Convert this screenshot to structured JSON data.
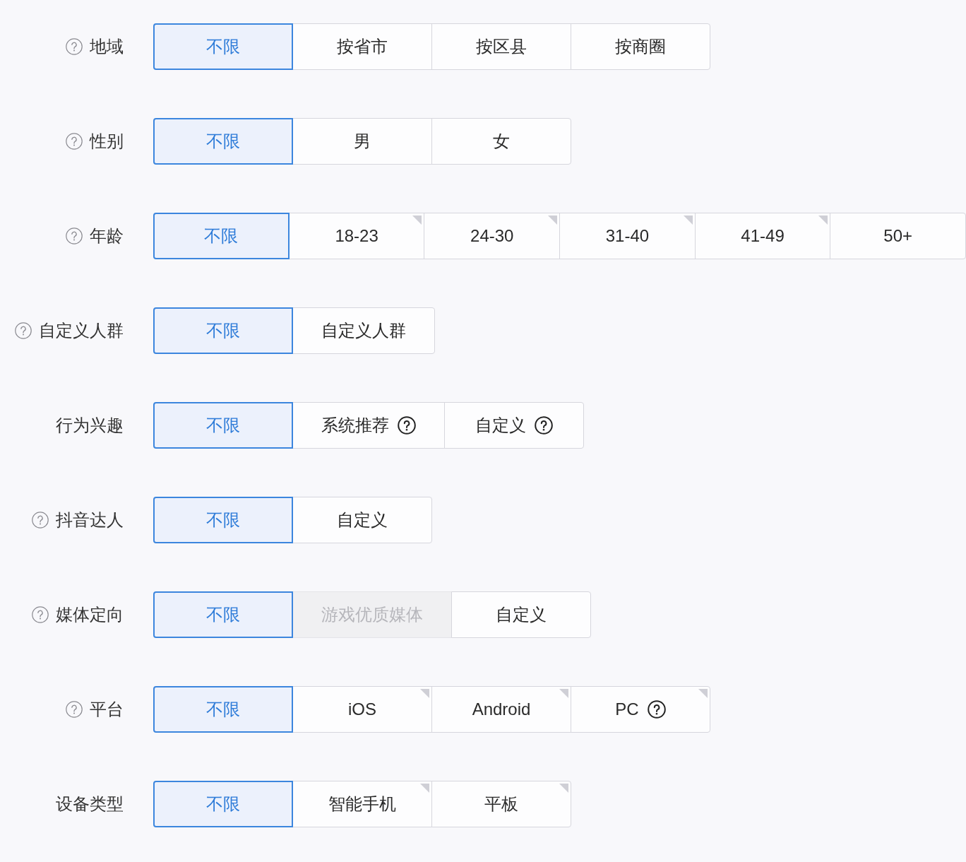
{
  "rows": [
    {
      "label": "地域",
      "help": true,
      "options": [
        {
          "label": "不限",
          "selected": true,
          "disabled": false,
          "corner_mark": false,
          "help": false
        },
        {
          "label": "按省市",
          "selected": false,
          "disabled": false,
          "corner_mark": false,
          "help": false
        },
        {
          "label": "按区县",
          "selected": false,
          "disabled": false,
          "corner_mark": false,
          "help": false
        },
        {
          "label": "按商圈",
          "selected": false,
          "disabled": false,
          "corner_mark": false,
          "help": false
        }
      ]
    },
    {
      "label": "性别",
      "help": true,
      "options": [
        {
          "label": "不限",
          "selected": true,
          "disabled": false,
          "corner_mark": false,
          "help": false
        },
        {
          "label": "男",
          "selected": false,
          "disabled": false,
          "corner_mark": false,
          "help": false
        },
        {
          "label": "女",
          "selected": false,
          "disabled": false,
          "corner_mark": false,
          "help": false
        }
      ]
    },
    {
      "label": "年龄",
      "help": true,
      "options": [
        {
          "label": "不限",
          "selected": true,
          "disabled": false,
          "corner_mark": false,
          "help": false
        },
        {
          "label": "18-23",
          "selected": false,
          "disabled": false,
          "corner_mark": true,
          "help": false
        },
        {
          "label": "24-30",
          "selected": false,
          "disabled": false,
          "corner_mark": true,
          "help": false
        },
        {
          "label": "31-40",
          "selected": false,
          "disabled": false,
          "corner_mark": true,
          "help": false
        },
        {
          "label": "41-49",
          "selected": false,
          "disabled": false,
          "corner_mark": true,
          "help": false
        },
        {
          "label": "50+",
          "selected": false,
          "disabled": false,
          "corner_mark": false,
          "help": false
        }
      ]
    },
    {
      "label": "自定义人群",
      "help": true,
      "options": [
        {
          "label": "不限",
          "selected": true,
          "disabled": false,
          "corner_mark": false,
          "help": false
        },
        {
          "label": "自定义人群",
          "selected": false,
          "disabled": false,
          "corner_mark": false,
          "help": false
        }
      ]
    },
    {
      "label": "行为兴趣",
      "help": false,
      "options": [
        {
          "label": "不限",
          "selected": true,
          "disabled": false,
          "corner_mark": false,
          "help": false
        },
        {
          "label": "系统推荐",
          "selected": false,
          "disabled": false,
          "corner_mark": false,
          "help": true
        },
        {
          "label": "自定义",
          "selected": false,
          "disabled": false,
          "corner_mark": false,
          "help": true
        }
      ]
    },
    {
      "label": "抖音达人",
      "help": true,
      "options": [
        {
          "label": "不限",
          "selected": true,
          "disabled": false,
          "corner_mark": false,
          "help": false
        },
        {
          "label": "自定义",
          "selected": false,
          "disabled": false,
          "corner_mark": false,
          "help": false
        }
      ]
    },
    {
      "label": "媒体定向",
      "help": true,
      "options": [
        {
          "label": "不限",
          "selected": true,
          "disabled": false,
          "corner_mark": false,
          "help": false
        },
        {
          "label": "游戏优质媒体",
          "selected": false,
          "disabled": true,
          "corner_mark": false,
          "help": false
        },
        {
          "label": "自定义",
          "selected": false,
          "disabled": false,
          "corner_mark": false,
          "help": false
        }
      ]
    },
    {
      "label": "平台",
      "help": true,
      "options": [
        {
          "label": "不限",
          "selected": true,
          "disabled": false,
          "corner_mark": false,
          "help": false
        },
        {
          "label": "iOS",
          "selected": false,
          "disabled": false,
          "corner_mark": true,
          "help": false
        },
        {
          "label": "Android",
          "selected": false,
          "disabled": false,
          "corner_mark": true,
          "help": false
        },
        {
          "label": "PC",
          "selected": false,
          "disabled": false,
          "corner_mark": true,
          "help": true
        }
      ]
    },
    {
      "label": "设备类型",
      "help": false,
      "options": [
        {
          "label": "不限",
          "selected": true,
          "disabled": false,
          "corner_mark": false,
          "help": false
        },
        {
          "label": "智能手机",
          "selected": false,
          "disabled": false,
          "corner_mark": true,
          "help": false
        },
        {
          "label": "平板",
          "selected": false,
          "disabled": false,
          "corner_mark": true,
          "help": false
        }
      ]
    }
  ]
}
